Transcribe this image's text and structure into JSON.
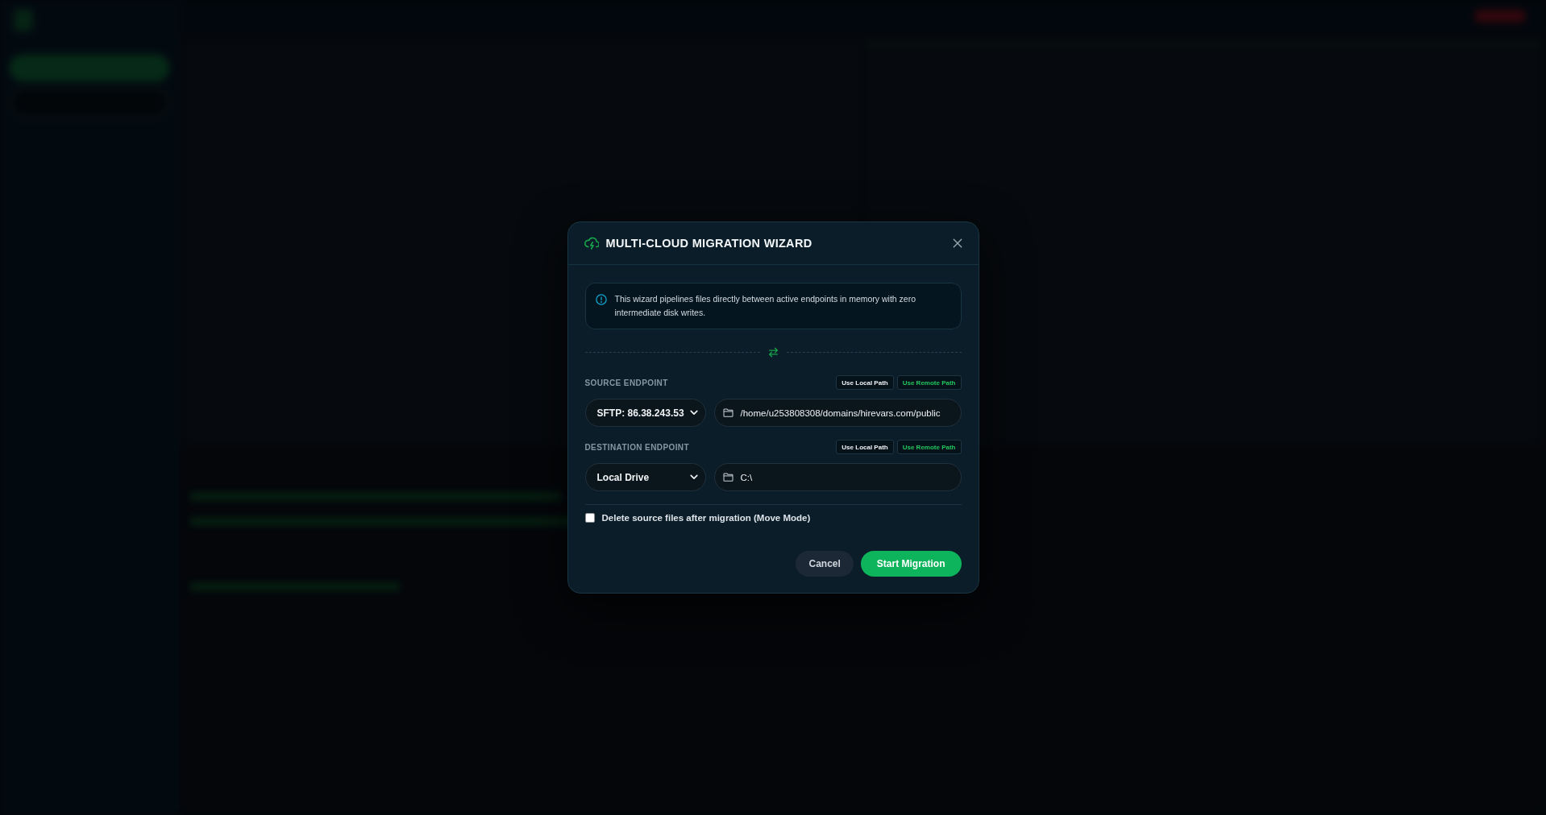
{
  "dialog": {
    "title": "MULTI-CLOUD MIGRATION WIZARD",
    "info": "This wizard pipelines files directly between active endpoints in memory with zero intermediate disk writes.",
    "endpoints": [
      {
        "label": "SOURCE ENDPOINT",
        "path_buttons": [
          {
            "label": "Use Local Path",
            "kind": "local"
          },
          {
            "label": "Use Remote Path",
            "kind": "remote"
          }
        ],
        "endpoint": "SFTP: 86.38.243.53",
        "path": "/home/u253808308/domains/hirevars.com/public"
      },
      {
        "label": "DESTINATION ENDPOINT",
        "path_buttons": [
          {
            "label": "Use Local Path",
            "kind": "local"
          },
          {
            "label": "Use Remote Path",
            "kind": "remote"
          }
        ],
        "endpoint": "Local Drive",
        "path": "C:\\"
      }
    ],
    "move_mode": {
      "label": "Delete source files after migration (Move Mode)",
      "checked": false
    },
    "buttons": [
      {
        "label": "Cancel",
        "kind": "secondary"
      },
      {
        "label": "Start Migration",
        "kind": "primary"
      }
    ]
  }
}
